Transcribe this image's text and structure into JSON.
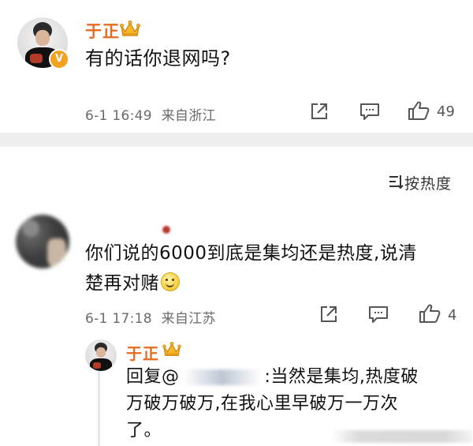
{
  "post": {
    "author": "于正",
    "text": "有的话你退网吗?",
    "time": "6-1 16:49",
    "location": "来自浙江",
    "likes": "49",
    "verified_label": "V",
    "icons": {
      "share": "share-icon",
      "comment": "comment-icon",
      "like": "like-icon",
      "crown": "crown-icon"
    }
  },
  "comments_header": {
    "sort_label": "按热度",
    "sort_icon": "sort-icon"
  },
  "comment": {
    "text_line1": "你们说的6000到底是集均还是热度,说清",
    "text_line2": "楚再对赌",
    "time": "6-1 17:18",
    "location": "来自江苏",
    "likes": "4",
    "emoji": "smile-emoji"
  },
  "reply": {
    "author": "于正",
    "prefix": "回复@",
    "line1_rest": ":当然是集均,热度破",
    "line2": "万破万破万,在我心里早破万一万次",
    "line3": "了。"
  },
  "colors": {
    "username": "#e76b1f",
    "badge": "#f3a21f",
    "separator": "#eeeeee",
    "meta_text": "#6b6b6b"
  }
}
